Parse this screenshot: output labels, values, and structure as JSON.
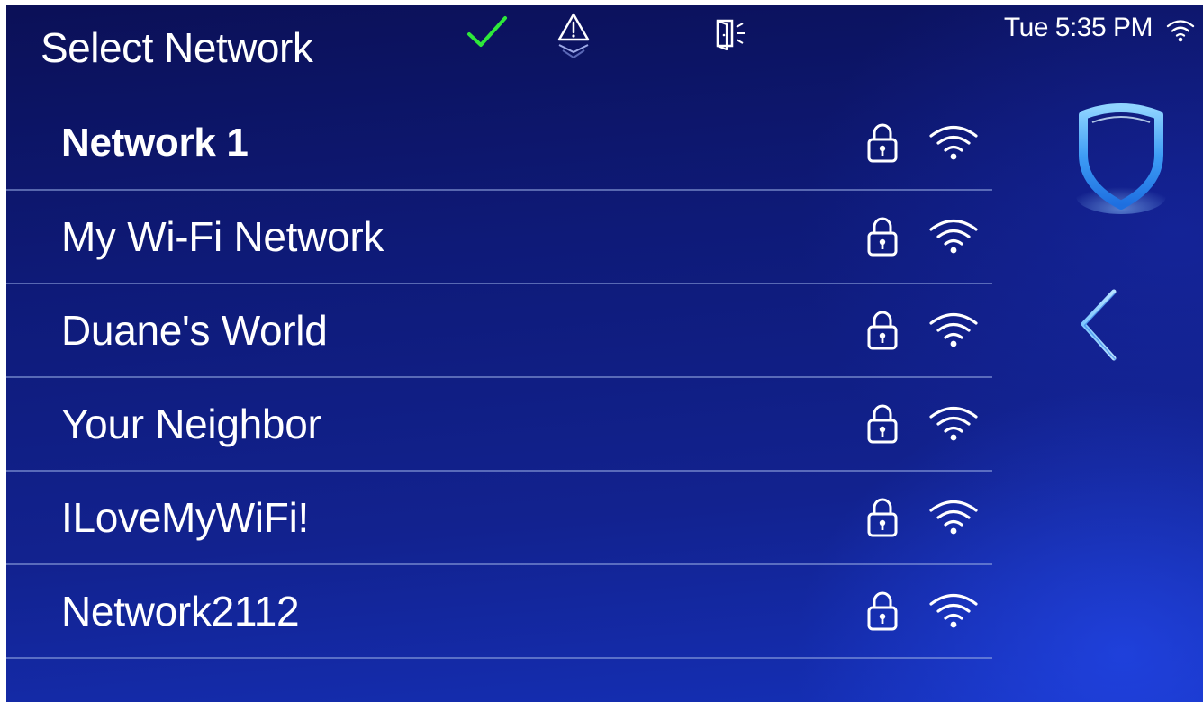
{
  "header": {
    "title": "Select Network",
    "status_icons": [
      "check-icon",
      "alert-icon",
      "door-icon"
    ],
    "time": "Tue 5:35 PM",
    "wifi_status_icon": "wifi-icon"
  },
  "networks": [
    {
      "name": "Network 1",
      "selected": true,
      "secured": true,
      "signal": "full"
    },
    {
      "name": "My Wi-Fi Network",
      "selected": false,
      "secured": true,
      "signal": "full"
    },
    {
      "name": "Duane's World",
      "selected": false,
      "secured": true,
      "signal": "full"
    },
    {
      "name": "Your Neighbor",
      "selected": false,
      "secured": true,
      "signal": "full"
    },
    {
      "name": "ILoveMyWiFi!",
      "selected": false,
      "secured": true,
      "signal": "full"
    },
    {
      "name": "Network2112",
      "selected": false,
      "secured": true,
      "signal": "full"
    }
  ],
  "side_controls": {
    "shield_icon": "shield-icon",
    "back_icon": "back-arrow-icon"
  },
  "colors": {
    "check": "#2ee83a",
    "accent_blue": "#4aa8ff",
    "background_top": "#0b1057",
    "background_bottom": "#1530b8"
  }
}
